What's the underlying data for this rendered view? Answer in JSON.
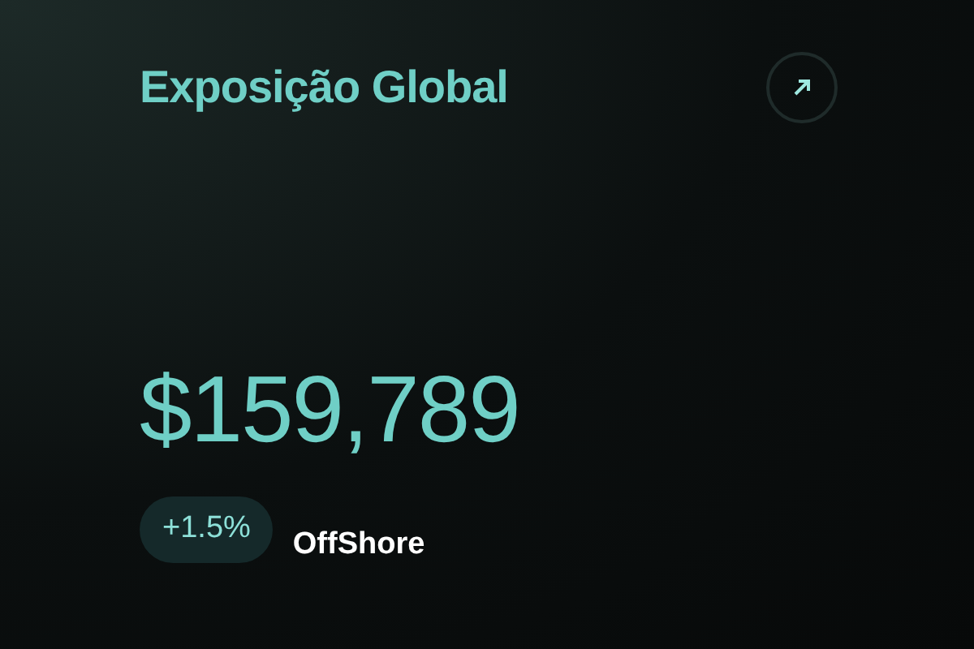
{
  "card": {
    "title": "Exposição Global",
    "amount": "$159,789",
    "change": "+1.5%",
    "label": "OffShore"
  }
}
